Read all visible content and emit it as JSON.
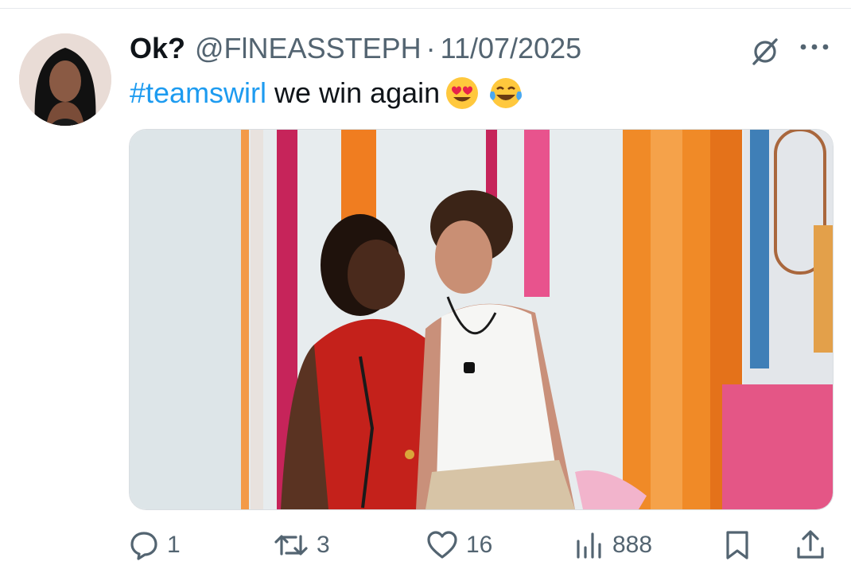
{
  "tweet": {
    "author": {
      "display_name": "Ok?",
      "handle": "@FlNEASSTEPH",
      "separator": "·",
      "date": "11/07/2025"
    },
    "text": {
      "hashtag": "#teamswirl",
      "body": "we win again",
      "emojis": [
        "heart-eyes-emoji",
        "tears-of-joy-emoji"
      ]
    },
    "media": {
      "alt": "photo"
    },
    "actions": {
      "replies": "1",
      "reposts": "3",
      "likes": "16",
      "views": "888"
    }
  },
  "colors": {
    "link": "#1d9bf0",
    "secondary_text": "#536471",
    "primary_text": "#0f1419"
  },
  "icons": [
    "grok-icon",
    "more-icon",
    "reply-icon",
    "repost-icon",
    "like-icon",
    "views-icon",
    "bookmark-icon",
    "share-icon"
  ]
}
